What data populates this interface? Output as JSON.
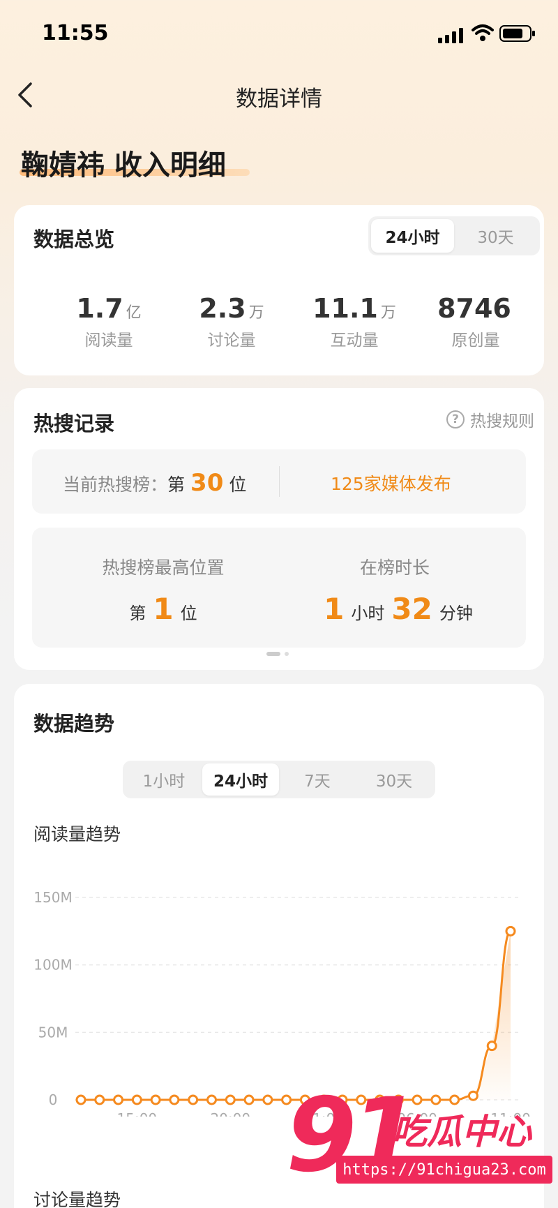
{
  "status_bar": {
    "time": "11:55"
  },
  "nav": {
    "title": "数据详情"
  },
  "page_heading": "鞠婧祎 收入明细",
  "overview": {
    "title": "数据总览",
    "tabs": [
      "24小时",
      "30天"
    ],
    "active_tab": "24小时",
    "metrics": [
      {
        "value": "1.7",
        "unit": "亿",
        "label": "阅读量"
      },
      {
        "value": "2.3",
        "unit": "万",
        "label": "讨论量"
      },
      {
        "value": "11.1",
        "unit": "万",
        "label": "互动量"
      },
      {
        "value": "8746",
        "unit": "",
        "label": "原创量"
      }
    ]
  },
  "hot_search": {
    "title": "热搜记录",
    "rule_label": "热搜规则",
    "current_rank_prefix": "当前热搜榜：",
    "rank_word_pre": "第",
    "current_rank": "30",
    "rank_word_post": "位",
    "media_count": "125家媒体发布",
    "peak_title": "热搜榜最高位置",
    "peak_rank": "1",
    "duration_title": "在榜时长",
    "duration_hours": "1",
    "hours_unit": "小时",
    "duration_minutes": "32",
    "minutes_unit": "分钟"
  },
  "trend": {
    "title": "数据趋势",
    "tabs": [
      "1小时",
      "24小时",
      "7天",
      "30天"
    ],
    "active_tab": "24小时",
    "read_trend_label": "阅读量趋势",
    "discuss_trend_label": "讨论量趋势"
  },
  "chart_data": {
    "type": "line",
    "title": "阅读量趋势",
    "y_tick_labels": [
      "0",
      "50M",
      "100M",
      "150M"
    ],
    "ylim": [
      0,
      150
    ],
    "y_unit": "M",
    "x_tick_labels": [
      "15:00",
      "20:00",
      "01:00",
      "06:00",
      "11:00"
    ],
    "x_tick_index": [
      3,
      8,
      13,
      18,
      23
    ],
    "grid": true,
    "accent": "#f58a1f",
    "series": [
      {
        "values": [
          0,
          0,
          0,
          0,
          0,
          0,
          0,
          0,
          0,
          0,
          0,
          0,
          0,
          0,
          0,
          0,
          0,
          0,
          0,
          0,
          0,
          3,
          40,
          125
        ]
      }
    ]
  },
  "watermark": {
    "logo_num": "91",
    "logo_text": "吃瓜中心",
    "url": "https://91chigua23.com"
  },
  "colors": {
    "accent": "#f08a17",
    "brand_watermark": "#ef2a5a"
  }
}
